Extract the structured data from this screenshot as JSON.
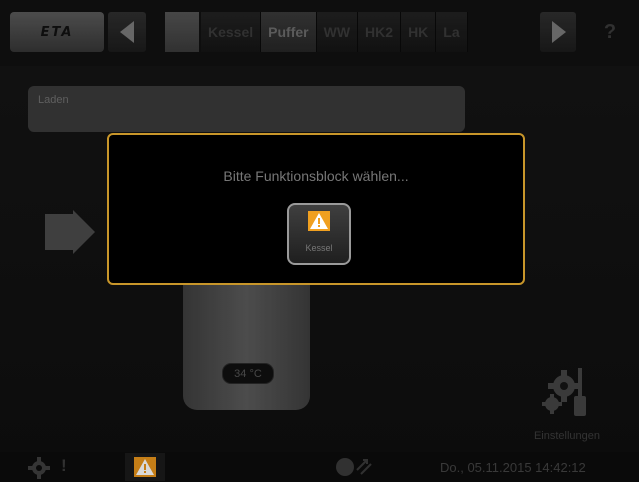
{
  "top_bar": {
    "logo": "ETA",
    "tabs": [
      {
        "label": "Kessel",
        "active": false
      },
      {
        "label": "Puffer",
        "active": true
      },
      {
        "label": "WW",
        "active": false
      },
      {
        "label": "HK2",
        "active": false
      },
      {
        "label": "HK",
        "active": false
      },
      {
        "label": "La",
        "active": false
      }
    ],
    "help_label": "?"
  },
  "content": {
    "field_label": "Laden",
    "temperature": "34 °C",
    "settings_label": "Einstellungen"
  },
  "modal": {
    "message": "Bitte Funktionsblock wählen...",
    "button_label": "Kessel",
    "border_color": "#c8962a",
    "warning_color": "#f0a020"
  },
  "bottom_bar": {
    "exclamation": "!",
    "datetime": "Do., 05.11.2015 14:42:12"
  }
}
